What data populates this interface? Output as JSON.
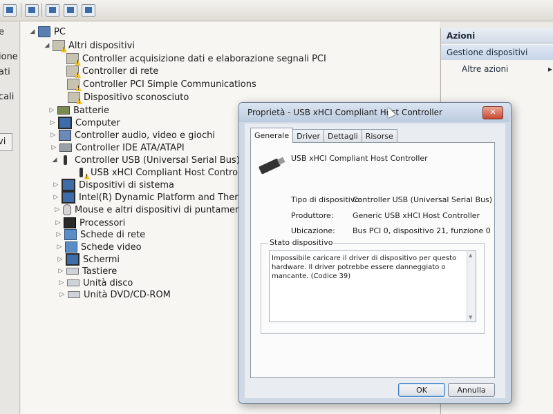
{
  "left_panel": {
    "clipped_texts": [
      "e",
      "ione",
      "ati",
      "cali",
      "vi"
    ]
  },
  "tree": {
    "root": "PC",
    "altri": {
      "label": "Altri dispositivi",
      "children": [
        "Controller acquisizione dati e elaborazione segnali PCI",
        "Controller di rete",
        "Controller PCI Simple Communications",
        "Dispositivo sconosciuto"
      ]
    },
    "categories": {
      "batterie": "Batterie",
      "computer": "Computer",
      "audio": "Controller audio, video e giochi",
      "ide": "Controller IDE ATA/ATAPI",
      "usb": "Controller USB (Universal Serial Bus)",
      "usb_child": "USB xHCI Compliant Host Controller",
      "sistema": "Dispositivi di sistema",
      "intel": "Intel(R) Dynamic Platform and Thermal Fram",
      "mouse": "Mouse e altri dispositivi di puntamento",
      "processori": "Processori",
      "rete": "Schede di rete",
      "video": "Schede video",
      "schermi": "Schermi",
      "tastiere": "Tastiere",
      "disco": "Unità disco",
      "dvd": "Unità DVD/CD-ROM"
    }
  },
  "actions": {
    "header": "Azioni",
    "selected": "Gestione dispositivi",
    "more": "Altre azioni",
    "chevron": "▸"
  },
  "dialog": {
    "title": "Proprietà - USB xHCI Compliant Host Controller",
    "close_glyph": "✕",
    "tabs": [
      "Generale",
      "Driver",
      "Dettagli",
      "Risorse"
    ],
    "device_name": "USB xHCI Compliant Host Controller",
    "properties": {
      "type_label": "Tipo di dispositivo:",
      "type_value": "Controller USB (Universal Serial Bus)",
      "manufacturer_label": "Produttore:",
      "manufacturer_value": "Generic USB xHCI Host Controller",
      "location_label": "Ubicazione:",
      "location_value": "Bus PCI 0, dispositivo 21, funzione 0"
    },
    "status_group_label": "Stato dispositivo",
    "status_text": "Impossibile caricare il driver di dispositivo per questo hardware. Il driver potrebbe essere danneggiato o mancante. (Codice 39)",
    "ok_label": "OK",
    "cancel_label": "Annulla"
  }
}
